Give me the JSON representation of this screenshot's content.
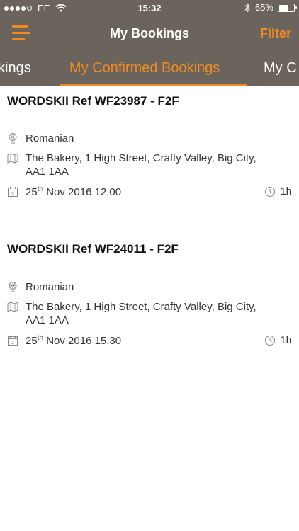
{
  "status_bar": {
    "carrier": "EE",
    "time": "15:32",
    "battery": "65%",
    "battery_level": 0.65,
    "signal_bars": 4
  },
  "navbar": {
    "title": "My Bookings",
    "filter_label": "Filter"
  },
  "tabs": {
    "prev_label": "kings",
    "active_label": "My Confirmed Bookings",
    "next_label": "My C"
  },
  "bookings": [
    {
      "title": "WORDSKII Ref WF23987 - F2F",
      "language": "Romanian",
      "address_line1": "The Bakery, 1 High Street, Crafty Valley, Big City,",
      "address_line2": "AA1 1AA",
      "day": "25",
      "day_suffix": "th",
      "date_rest": " Nov 2016 12.00",
      "duration": "1h"
    },
    {
      "title": "WORDSKII Ref WF24011 - F2F",
      "language": "Romanian",
      "address_line1": "The Bakery, 1 High Street, Crafty Valley, Big City,",
      "address_line2": "AA1 1AA",
      "day": "25",
      "day_suffix": "th",
      "date_rest": " Nov 2016 15.30",
      "duration": "1h"
    }
  ],
  "colors": {
    "accent": "#f08a24",
    "header_bg": "#6a645c"
  }
}
